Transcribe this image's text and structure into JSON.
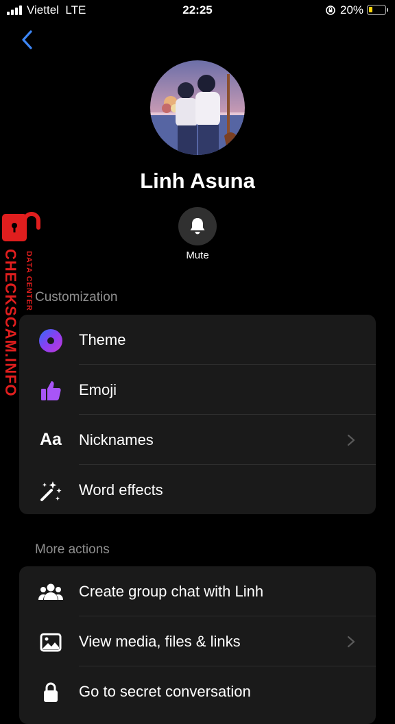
{
  "status": {
    "carrier": "Viettel  LTE",
    "time": "22:25",
    "battery": "20%"
  },
  "profile": {
    "name": "Linh Asuna",
    "mute_label": "Mute"
  },
  "customization": {
    "title": "Customization",
    "items": [
      {
        "label": "Theme",
        "icon": "theme-icon"
      },
      {
        "label": "Emoji",
        "icon": "thumbs-up-icon"
      },
      {
        "label": "Nicknames",
        "icon": "nicknames-icon",
        "glyph": "Aa"
      },
      {
        "label": "Word effects",
        "icon": "magic-wand-icon"
      }
    ]
  },
  "more_actions": {
    "title": "More actions",
    "items": [
      {
        "label": "Create group chat with Linh",
        "icon": "group-icon"
      },
      {
        "label": "View media, files & links",
        "icon": "image-icon"
      },
      {
        "label": "Go to secret conversation",
        "icon": "lock-icon"
      }
    ]
  },
  "watermark": {
    "line1": "CHECKSCAM.INFO",
    "line2": "DATA CENTER"
  },
  "colors": {
    "accent_blue": "#3d86f5",
    "emoji_purple": "#a855f7",
    "watermark_red": "#e01e1e"
  }
}
